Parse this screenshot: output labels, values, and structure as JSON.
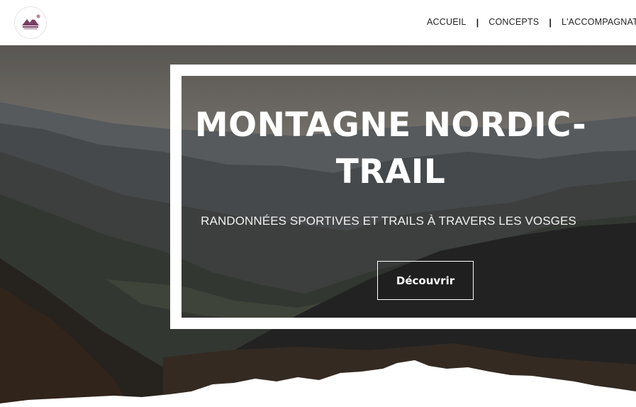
{
  "header": {
    "logo_name": "logo-icon",
    "nav": [
      {
        "label": "ACCUEIL"
      },
      {
        "label": "CONCEPTS"
      },
      {
        "label": "L'ACCOMPAGNATI"
      }
    ],
    "separator": "|"
  },
  "hero": {
    "title_line1": "MONTAGNE NORDIC-",
    "title_line2": "TRAIL",
    "subtitle": "RANDONNÉES SPORTIVES ET TRAILS À TRAVERS LES VOSGES",
    "button_label": "Découvrir"
  },
  "colors": {
    "header_bg": "#ffffff",
    "nav_text": "#222222",
    "hero_text": "#ffffff",
    "frame": "#ffffff"
  }
}
